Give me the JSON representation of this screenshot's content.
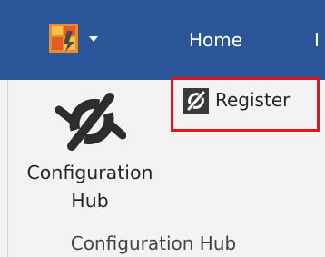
{
  "colors": {
    "titlebar": "#2b579a",
    "ribbon": "#f3f3f3",
    "highlight_border": "#e0161b",
    "text": "#262626"
  },
  "titlebar": {
    "app_icon": "app-logo-icon",
    "dropdown_icon": "chevron-down-icon",
    "tabs": [
      {
        "label": "Home"
      },
      {
        "label": "I"
      }
    ]
  },
  "ribbon": {
    "configuration_hub_button": {
      "icon": "configuration-hub-icon",
      "label_line1": "Configuration",
      "label_line2": "Hub"
    },
    "register_button": {
      "icon": "register-icon",
      "label": "Register"
    },
    "group_label": "Configuration Hub"
  }
}
